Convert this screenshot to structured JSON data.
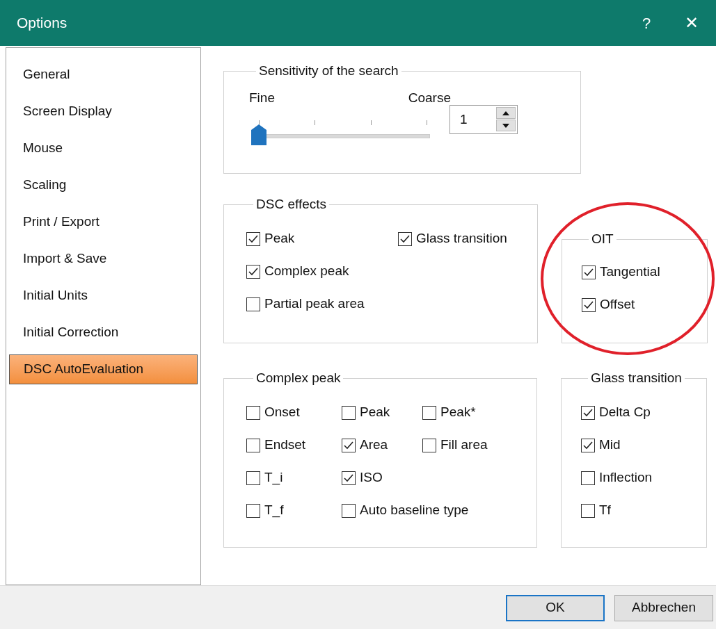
{
  "window": {
    "title": "Options",
    "help": "?",
    "close": "✕"
  },
  "sidebar": {
    "items": [
      {
        "label": "General",
        "selected": false
      },
      {
        "label": "Screen Display",
        "selected": false
      },
      {
        "label": "Mouse",
        "selected": false
      },
      {
        "label": "Scaling",
        "selected": false
      },
      {
        "label": "Print / Export",
        "selected": false
      },
      {
        "label": "Import & Save",
        "selected": false
      },
      {
        "label": "Initial Units",
        "selected": false
      },
      {
        "label": "Initial Correction",
        "selected": false
      },
      {
        "label": "DSC AutoEvaluation",
        "selected": true
      }
    ]
  },
  "sensitivity": {
    "title": "Sensitivity of the search",
    "min_label": "Fine",
    "max_label": "Coarse",
    "level": 0,
    "value": "1"
  },
  "dsc_effects": {
    "title": "DSC effects",
    "rows": [
      [
        {
          "label": "Peak",
          "checked": true
        },
        {
          "label": "Glass transition",
          "checked": true
        }
      ],
      [
        {
          "label": "Complex peak",
          "checked": true
        }
      ],
      [
        {
          "label": "Partial peak area",
          "checked": false
        }
      ]
    ]
  },
  "oit": {
    "title": "OIT",
    "highlighted": true,
    "rows": [
      [
        {
          "label": "Tangential",
          "checked": true
        }
      ],
      [
        {
          "label": "Offset",
          "checked": true
        }
      ]
    ]
  },
  "complex_peak": {
    "title": "Complex peak",
    "rows": [
      [
        {
          "label": "Onset",
          "checked": false
        },
        {
          "label": "Peak",
          "checked": false
        },
        {
          "label": "Peak*",
          "checked": false
        }
      ],
      [
        {
          "label": "Endset",
          "checked": false
        },
        {
          "label": "Area",
          "checked": true
        },
        {
          "label": "Fill area",
          "checked": false
        }
      ],
      [
        {
          "label": "T_i",
          "checked": false
        },
        {
          "label": "ISO",
          "checked": true
        }
      ],
      [
        {
          "label": "T_f",
          "checked": false
        },
        {
          "label": "Auto baseline type",
          "checked": false
        }
      ]
    ]
  },
  "glass_transition": {
    "title": "Glass transition",
    "rows": [
      [
        {
          "label": "Delta Cp",
          "checked": true
        }
      ],
      [
        {
          "label": "Mid",
          "checked": true
        }
      ],
      [
        {
          "label": "Inflection",
          "checked": false
        }
      ],
      [
        {
          "label": "Tf",
          "checked": false
        }
      ]
    ]
  },
  "buttons": [
    {
      "label": "OK",
      "default": true
    },
    {
      "label": "Abbrechen",
      "default": false
    }
  ]
}
